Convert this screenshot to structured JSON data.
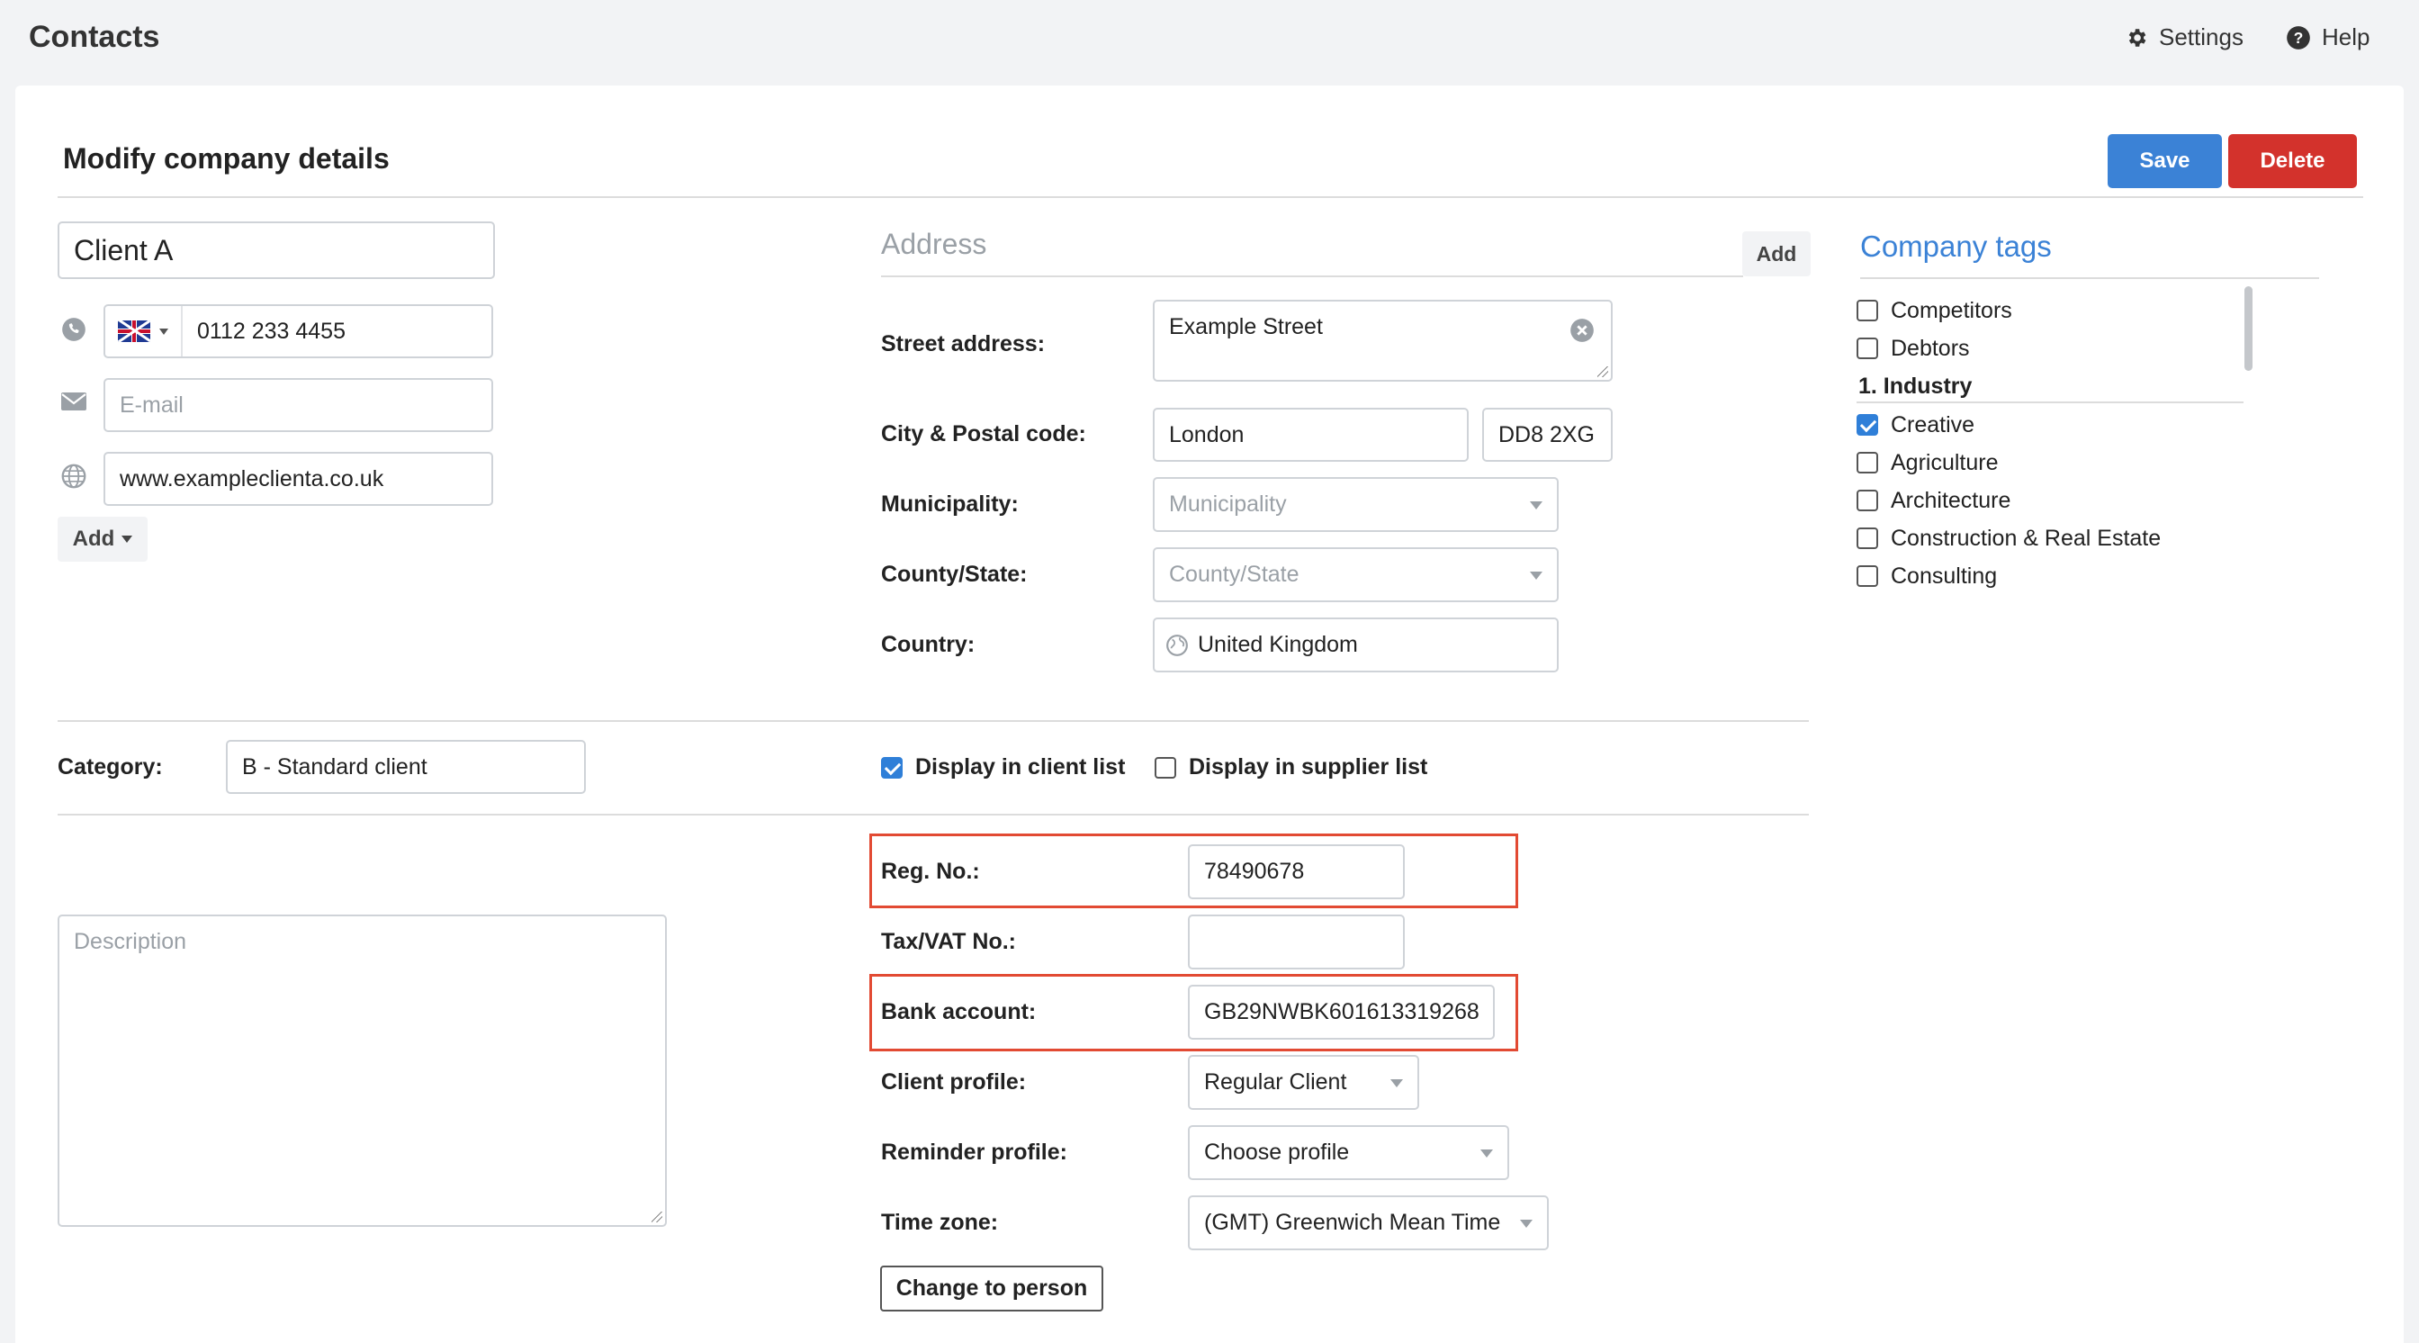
{
  "app": {
    "title": "Contacts"
  },
  "topnav": {
    "settings": "Settings",
    "help": "Help"
  },
  "page": {
    "title": "Modify company details"
  },
  "actions": {
    "save": "Save",
    "delete": "Delete"
  },
  "company": {
    "name": "Client A",
    "phone": "0112 233 4455",
    "phone_country": "gb-flag-icon",
    "email_placeholder": "E-mail",
    "website": "www.exampleclienta.co.uk",
    "add_label": "Add"
  },
  "address": {
    "title": "Address",
    "add_label": "Add",
    "street_label": "Street address:",
    "street": "Example Street",
    "city_label": "City & Postal code:",
    "city": "London",
    "postal_code": "DD8 2XG",
    "municipality_label": "Municipality:",
    "municipality_placeholder": "Municipality",
    "county_label": "County/State:",
    "county_placeholder": "County/State",
    "country_label": "Country:",
    "country": "United Kingdom"
  },
  "tags": {
    "title": "Company tags",
    "items": [
      {
        "label": "Competitors",
        "checked": false
      },
      {
        "label": "Debtors",
        "checked": false
      }
    ],
    "group_label": "1. Industry",
    "industry": [
      {
        "label": "Creative",
        "checked": true
      },
      {
        "label": "Agriculture",
        "checked": false
      },
      {
        "label": "Architecture",
        "checked": false
      },
      {
        "label": "Construction & Real Estate",
        "checked": false
      },
      {
        "label": "Consulting",
        "checked": false
      }
    ]
  },
  "category": {
    "label": "Category:",
    "value": "B - Standard client"
  },
  "display": {
    "client_list": {
      "label": "Display in client list",
      "checked": true
    },
    "supplier_list": {
      "label": "Display in supplier list",
      "checked": false
    }
  },
  "description": {
    "placeholder": "Description"
  },
  "details": {
    "reg_label": "Reg. No.:",
    "reg_value": "78490678",
    "tax_label": "Tax/VAT No.:",
    "tax_value": "",
    "bank_label": "Bank account:",
    "bank_value": "GB29NWBK601613319268",
    "client_profile_label": "Client profile:",
    "client_profile_value": "Regular Client",
    "reminder_label": "Reminder profile:",
    "reminder_value": "Choose profile",
    "timezone_label": "Time zone:",
    "timezone_value": "(GMT) Greenwich Mean Time",
    "change_button": "Change to person"
  },
  "colors": {
    "primary": "#3b82d6",
    "danger": "#d3322c",
    "highlight": "#e24a33",
    "checkbox": "#2f7fd8"
  }
}
